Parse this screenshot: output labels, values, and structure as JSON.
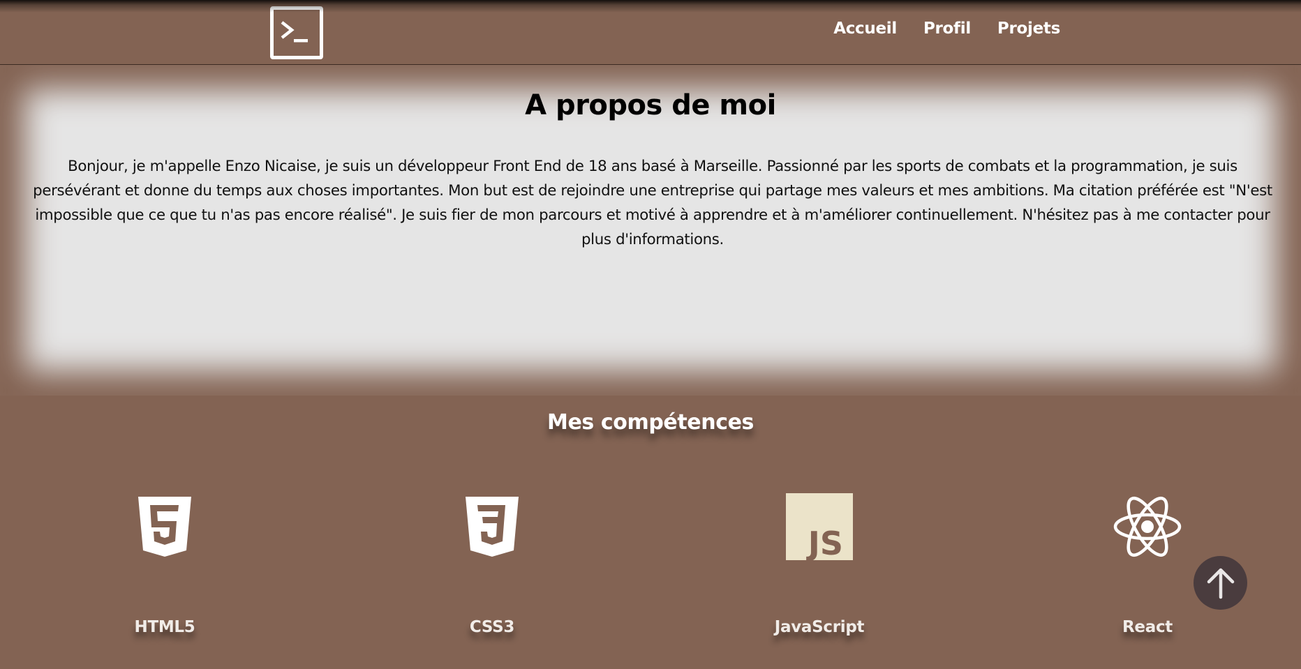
{
  "nav": {
    "logo_icon": "terminal-icon",
    "links": [
      "Accueil",
      "Profil",
      "Projets"
    ]
  },
  "about": {
    "title": "A propos de moi",
    "text": "Bonjour, je m'appelle Enzo Nicaise, je suis un développeur Front End de 18 ans basé à Marseille. Passionné par les sports de combats et la programmation, je suis persévérant et donne du temps aux choses importantes. Mon but est de rejoindre une entreprise qui partage mes valeurs et mes ambitions. Ma citation préférée est \"N'est impossible que ce que tu n'as pas encore réalisé\". Je suis fier de mon parcours et motivé à apprendre et à m'améliorer continuellement. N'hésitez pas à me contacter pour plus d'informations."
  },
  "skills": {
    "title": "Mes compétences",
    "items": [
      {
        "label": "HTML5",
        "icon": "html5-icon"
      },
      {
        "label": "CSS3",
        "icon": "css3-icon"
      },
      {
        "label": "JavaScript",
        "icon": "javascript-icon"
      },
      {
        "label": "React",
        "icon": "react-icon"
      }
    ]
  },
  "scroll_top": {
    "icon": "arrow-up-icon"
  },
  "colors": {
    "background": "#836353",
    "about_background": "#e5e5e5",
    "js_badge": "#ebe3c9",
    "scroll_button": "#4a3c3e"
  }
}
